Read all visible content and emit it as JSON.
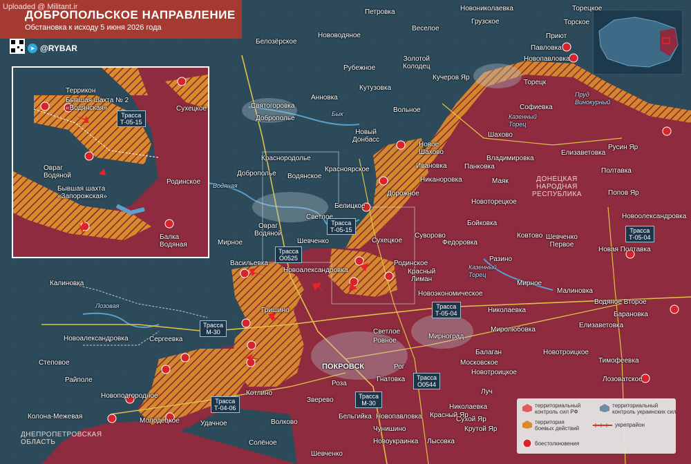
{
  "header": {
    "uploaded": "Uploaded @ Militant.ir",
    "title": "ДОБРОПОЛЬСКОЕ НАПРАВЛЕНИЕ",
    "subtitle": "Обстановка к исходу 5 июня 2026 года",
    "brand": "@RYBAR",
    "telegram_icon": "paper-plane-icon"
  },
  "colors": {
    "ukraine_territory": "#2c4a5a",
    "russia_territory": "#8e2b3e",
    "combat_zone": "#d98a2c",
    "title_bg": "#b0382c",
    "road": "#e0c24a",
    "river": "#5a9fd0"
  },
  "places": {
    "petrovka": "Петровка",
    "novonikolaevka": "Новониколаевка",
    "toretskoe": "Торецкое",
    "novovodyanoe": "Нововодяное",
    "veseloe": "Веселое",
    "gruzskoe": "Грузское",
    "torskoe": "Торское",
    "belozerskoe": "Белозёрское",
    "priyut": "Приют",
    "rubezhnoe": "Рубежное",
    "zolotoy_kolodets": "Золотой\nКолодец",
    "pavlovka": "Павловка",
    "novopavlovka": "Новопавловка",
    "kucherov_yar": "Кучеров Яр",
    "toretsk": "Торецк",
    "kutuzovka": "Кутузовка",
    "annovka": "Анновка",
    "svyatogorovka": "Святогоровка",
    "dobropolye": "Доброполье",
    "volnoe": "Вольное",
    "sofievka": "Софиевка",
    "novy_donbass": "Новый\nДонбасс",
    "shakhovo": "Шахово",
    "novoe_shakhovo": "Новое\nШахово",
    "rusin_yar": "Русин Яр",
    "elizavetovka": "Елизаветовка",
    "krasnopodolye": "Краснopодолье",
    "ivanovka": "Ивановка",
    "pankovka": "Панковка",
    "vladimirovka": "Владимировка",
    "poltavka": "Полтавка",
    "dobropolye2": "Доброполье",
    "krasnoyarskoe": "Красноярское",
    "vodyanskoe": "Водянское",
    "nikanorovka": "Никаноровка",
    "mayak": "Маяк",
    "dnr": "ДОНЕЦКАЯ\nНАРОДНАЯ\nРЕСПУБЛИКА",
    "popov_yar": "Попов Яр",
    "dorozhnoe": "Дорожное",
    "belitskoe": "Белицкое",
    "svetloe": "Светлое",
    "novotoretskoe": "Новоторецкое",
    "boykovka": "Бойковка",
    "novooleksandrovka_e": "Новоолександровка",
    "ovrag_vodyanoy": "Овраг\nВодяной",
    "mirnoe": "Мирное",
    "shevchenko": "Шевченко",
    "sukhetskoe": "Сухецкое",
    "suvorovo": "Суворово",
    "fedorovka": "Федоровка",
    "kotlino": "Котлино",
    "shevchenko_pervoe": "Шевченко\nПервое",
    "novaya_poltavka": "Новая Полтавка",
    "vasilevka": "Васильевка",
    "novoaleksandrovka": "Новоалександровка",
    "rodinskoe": "Родинское",
    "krasny_liman": "Красный\nЛиман",
    "razino": "Разино",
    "kalinovka": "Калиновка",
    "novoekonomicheskoe": "Новоэкономическое",
    "mirnoe2": "Мирное",
    "malinovka": "Малиновка",
    "vodyanoe_vtoroe": "Водяное Второе",
    "grishino": "Гришино",
    "nikolaevka": "Николаевка",
    "baranovka": "Барановка",
    "novoaleksandrovka_w": "Новоалександровка",
    "sergeevka": "Сергеевка",
    "svetloe2": "Светлое",
    "rovnoe": "Ровное",
    "mirnograd": "Мирноград",
    "elizavetovka2": "Елизаветовка",
    "miroлюбовка": "Миролюбовка",
    "balagan": "Балаган",
    "zhovtnevoe": "Новотроицкое",
    "timofeevka": "Тимофеевка",
    "stepovoe": "Степовое",
    "pokrovsk": "ПОКРОВСК",
    "rog": "Рог",
    "moskovskoe": "Московское",
    "novotroitskoe": "Новотроицкое",
    "lozovatskoe": "Лозоватское",
    "raypole": "Райполе",
    "roza": "Роза",
    "gnatovka": "Гнатовка",
    "luch": "Луч",
    "novopodgorodnoe": "Новоподгородное",
    "zverevo": "Зверево",
    "kolona_mezhevaya": "Колона-Межевая",
    "molodetskoe": "Молодецкое",
    "udachnoe": "Удачное",
    "belgiyka": "Бельгийка",
    "novopavlovka2": "Новопавловка",
    "nikolaevka2": "Николаевка",
    "sukhoy_yar": "Сухой Яр",
    "krasny_yar": "Красный Яр",
    "krutoy_yar": "Крутой Яр",
    "chunishino": "Чунишино",
    "volkovo": "Волково",
    "dnepr_oblast": "ДНЕПРОПЕТРОВСКАЯ\nОБЛАСТЬ",
    "solenoe": "Солёное",
    "novoukrainka": "Новоукраинка",
    "lysovka": "Лысовка",
    "shevchenko2": "Шевченко",
    "bolotovo": "Ковтово"
  },
  "water": {
    "byk": "Бык",
    "vodyanaya": "Водяная",
    "kazenny_torets": "Казенный\nТорец",
    "kazenny_torets2": "Казенный\nТорец",
    "prud": "Пруд\nВинокурный",
    "lozovaya": "Лозовая"
  },
  "roads": {
    "t0515": "Трасса\nТ-05-15",
    "o0525": "Трасса\nО0525",
    "t0504_a": "Трасса\nТ-05-04",
    "t0504_b": "Трасса\nТ-05-04",
    "m30_a": "Трасса\nМ-30",
    "m30_b": "Трасса\nМ-30",
    "o0544": "Трасса\nО0544",
    "t0406": "Трасса\nТ-04-06"
  },
  "inset": {
    "terrikon": "Террикон",
    "shakhta2": "Бывшая шахта № 2\n«Водянская»",
    "road": "Трасса\nТ-05-15",
    "sukhetskoe": "Сухецкое",
    "ovrag": "Овраг\nВодяной",
    "shakhta_zap": "Бывшая шахта\n«Запорожская»",
    "rodinskoe": "Родинское",
    "balka": "Балка\nВодяная"
  },
  "legend": {
    "ru_control": "территориальный\nконтроль сил РФ",
    "ua_control": "территориальный\nконтроль украинских сил",
    "combat": "территория\nбоевых действий",
    "fortified": "укрепрайон",
    "clashes": "боестолкновения"
  }
}
